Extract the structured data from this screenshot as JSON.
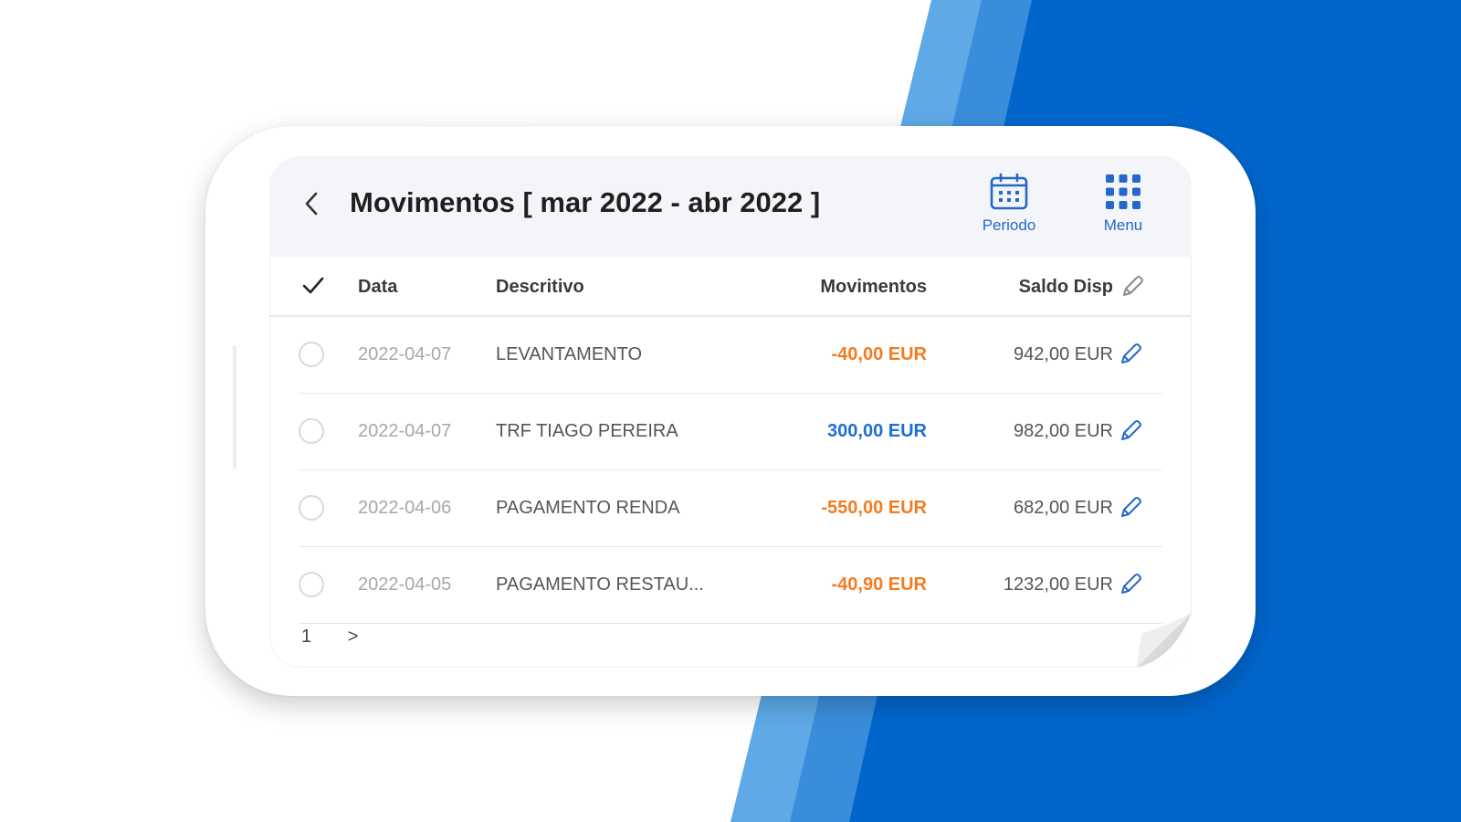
{
  "app": {
    "title": "Movimentos [ mar 2022 - abr 2022 ]",
    "accent_color": "#2468c9",
    "back_icon": "chevron-left-icon",
    "actions": [
      {
        "label": "Periodo",
        "icon": "calendar-icon"
      },
      {
        "label": "Menu",
        "icon": "grid-menu-icon"
      }
    ]
  },
  "table": {
    "headers": {
      "data": "Data",
      "descritivo": "Descritivo",
      "movimentos": "Movimentos",
      "saldo": "Saldo Disp"
    },
    "negative_color": "#f47c20",
    "positive_color": "#1f6ed4",
    "rows": [
      {
        "date": "2022-04-07",
        "description": "LEVANTAMENTO",
        "amount": "-40,00 EUR",
        "amount_type": "neg",
        "saldo": "942,00 EUR"
      },
      {
        "date": "2022-04-07",
        "description": "TRF TIAGO PEREIRA",
        "amount": "300,00 EUR",
        "amount_type": "pos",
        "saldo": "982,00 EUR"
      },
      {
        "date": "2022-04-06",
        "description": "PAGAMENTO RENDA",
        "amount": "-550,00 EUR",
        "amount_type": "neg",
        "saldo": "682,00 EUR"
      },
      {
        "date": "2022-04-05",
        "description": "PAGAMENTO RESTAU...",
        "amount": "-40,90 EUR",
        "amount_type": "neg",
        "saldo": "1232,00 EUR"
      }
    ]
  },
  "pager": {
    "current_page": "1",
    "next_label": ">"
  },
  "background": {
    "blue_dark": "#0066cc",
    "blue_light": "#5ea9e6"
  }
}
